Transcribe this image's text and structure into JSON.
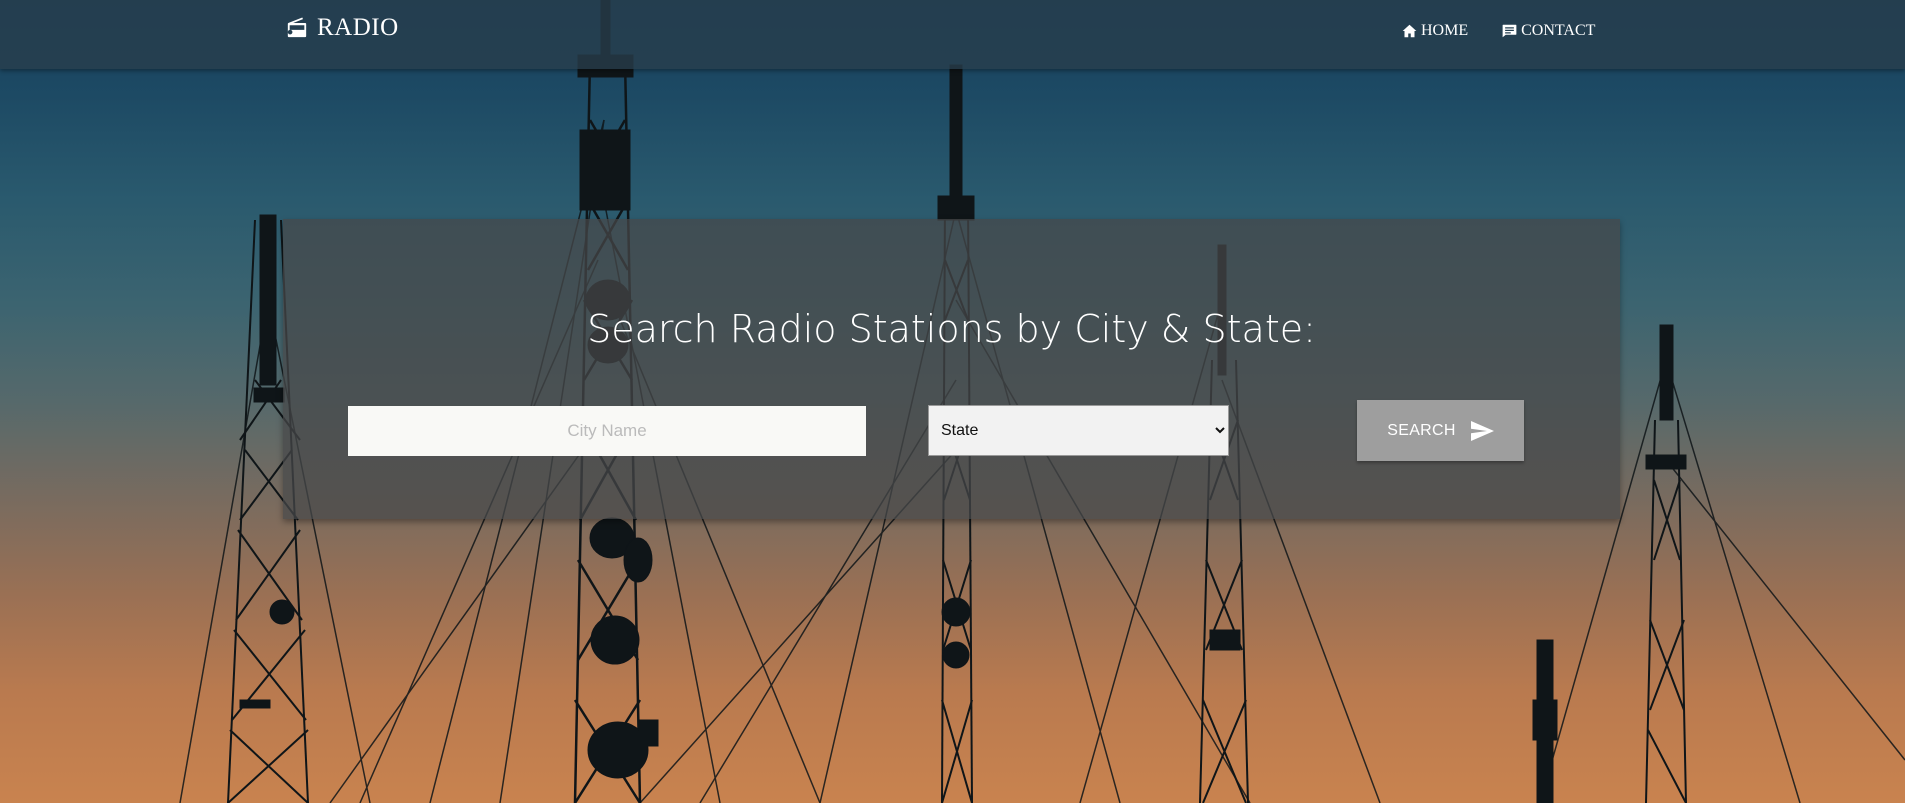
{
  "navbar": {
    "brand": "RADIO",
    "brand_icon": "radio-icon",
    "links": [
      {
        "label": "HOME",
        "icon": "home-icon"
      },
      {
        "label": "CONTACT",
        "icon": "message-icon"
      }
    ]
  },
  "search": {
    "title": "Search Radio Stations by City & State:",
    "city_placeholder": "City Name",
    "city_value": "",
    "state_selected": "State",
    "button_label": "SEARCH",
    "button_icon": "send-icon"
  },
  "colors": {
    "navbar_bg": "#283e4c",
    "panel_bg": "#464849",
    "button_bg": "#9e9e9e",
    "sky_top": "#18415e",
    "sky_bottom": "#c9834f",
    "silhouette": "#0f1518"
  }
}
